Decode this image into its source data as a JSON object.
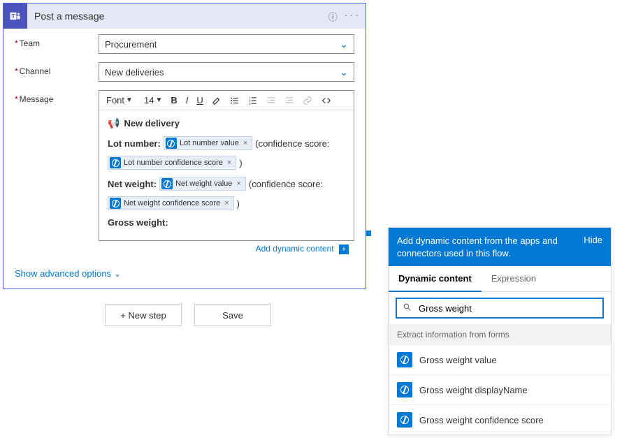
{
  "card": {
    "title": "Post a message",
    "teams_icon": "teams-icon",
    "fields": {
      "team": {
        "label": "Team",
        "required": true,
        "value": "Procurement"
      },
      "channel": {
        "label": "Channel",
        "required": true,
        "value": "New deliveries"
      },
      "message": {
        "label": "Message",
        "required": true
      }
    },
    "toolbar": {
      "font": "Font",
      "size": "14"
    },
    "editor": {
      "heading": "New delivery",
      "line1_label": "Lot number:",
      "token_lot_value": "Lot number value",
      "conf_open": "(confidence score:",
      "token_lot_conf": "Lot number confidence score",
      "conf_close": ")",
      "line2_label": "Net weight:",
      "token_net_value": "Net weight value",
      "token_net_conf": "Net weight confidence score",
      "line3_label": "Gross weight:"
    },
    "add_dynamic": "Add dynamic content",
    "show_advanced": "Show advanced options"
  },
  "footer": {
    "new_step": "+ New step",
    "save": "Save"
  },
  "dyn": {
    "header": "Add dynamic content from the apps and connectors used in this flow.",
    "hide": "Hide",
    "tab_dynamic": "Dynamic content",
    "tab_expression": "Expression",
    "search_value": "Gross weight",
    "section": "Extract information from forms",
    "items": [
      "Gross weight value",
      "Gross weight displayName",
      "Gross weight confidence score"
    ]
  }
}
